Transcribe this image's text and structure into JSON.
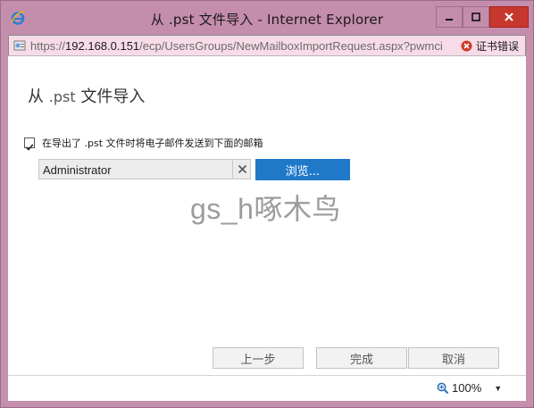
{
  "window": {
    "title": "从 .pst 文件导入 - Internet Explorer"
  },
  "address_bar": {
    "url_prefix": "https://",
    "url_host": "192.168.0.151",
    "url_path": "/ecp/UsersGroups/NewMailboxImportRequest.aspx?pwmci",
    "cert_error": "证书错误"
  },
  "dialog": {
    "title_prefix": "从",
    "title_ext": ".pst",
    "title_suffix": "文件导入",
    "checkbox_label": "在导出了 .pst 文件时将电子邮件发送到下面的邮箱",
    "checkbox_checked": true,
    "mailbox_value": "Administrator",
    "browse_label": "浏览...",
    "watermark": "gs_h啄木鸟"
  },
  "footer": {
    "back_label": "上一步",
    "finish_label": "完成",
    "cancel_label": "取消"
  },
  "statusbar": {
    "zoom": "100%"
  },
  "colors": {
    "titlebar": "#c48dac",
    "accent": "#1f78c8",
    "close": "#c7372d"
  }
}
